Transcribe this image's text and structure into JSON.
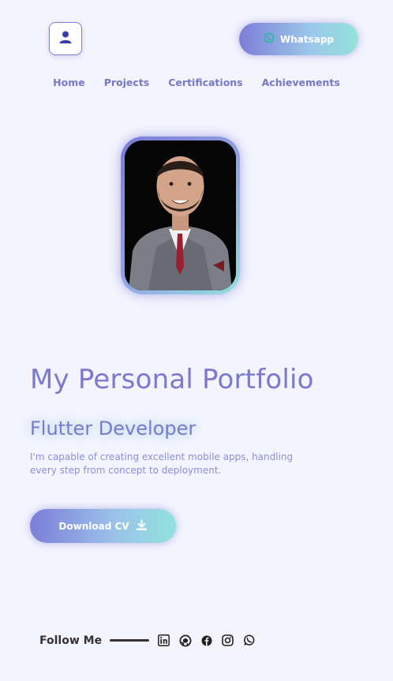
{
  "header": {
    "profile_icon": "user-icon",
    "whatsapp_label": "Whatsapp",
    "whatsapp_icon": "whatsapp-icon"
  },
  "nav": {
    "items": [
      "Home",
      "Projects",
      "Certifications",
      "Achievements"
    ]
  },
  "hero": {
    "title": "My Personal Portfolio",
    "subtitle": "Flutter Developer",
    "description": "I'm capable of creating excellent mobile apps, handling every step from concept to deployment.",
    "download_label": "Download CV",
    "download_icon": "download-icon"
  },
  "footer": {
    "follow_label": "Follow Me",
    "social": [
      "linkedin-icon",
      "github-icon",
      "facebook-icon",
      "instagram-icon",
      "whatsapp-icon"
    ]
  },
  "colors": {
    "accent": "#7b79cf",
    "teal": "#90e2dc",
    "background": "#f3f4fd"
  }
}
